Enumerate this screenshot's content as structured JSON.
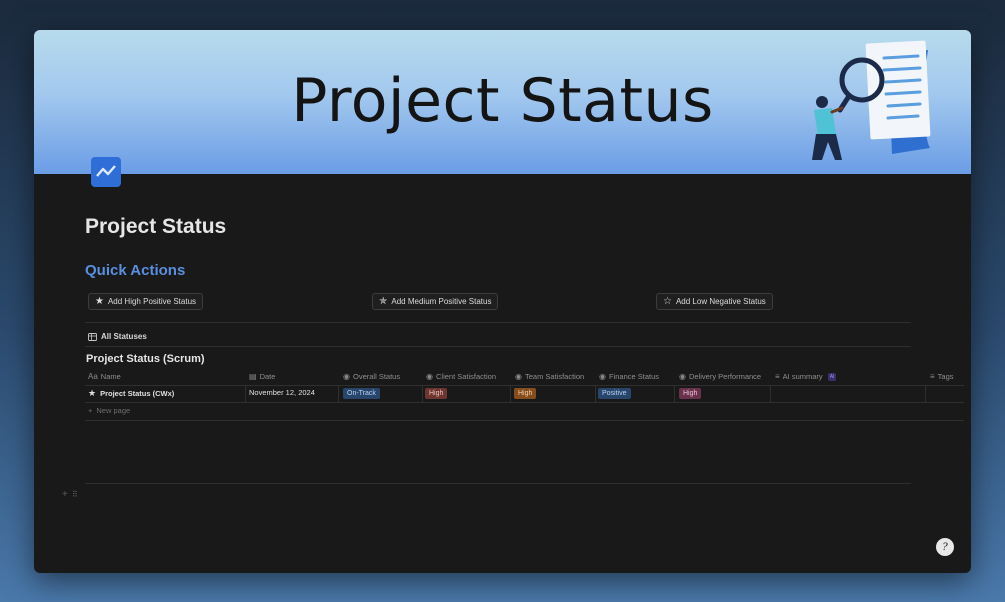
{
  "cover": {
    "title": "Project Status"
  },
  "page": {
    "title": "Project Status"
  },
  "quick_actions": {
    "heading": "Quick Actions",
    "buttons": [
      {
        "label": "Add High Positive Status",
        "icon": "star-filled-icon"
      },
      {
        "label": "Add Medium Positive Status",
        "icon": "star-sparkle-icon"
      },
      {
        "label": "Add Low Negative Status",
        "icon": "star-outline-icon"
      }
    ]
  },
  "view": {
    "tab_label": "All Statuses"
  },
  "database": {
    "title": "Project Status (Scrum)",
    "columns": [
      {
        "label": "Name",
        "icon": "Aa"
      },
      {
        "label": "Date",
        "icon": "calendar-icon"
      },
      {
        "label": "Overall Status",
        "icon": "status-icon"
      },
      {
        "label": "Client Satisfaction",
        "icon": "status-icon"
      },
      {
        "label": "Team Satisfaction",
        "icon": "status-icon"
      },
      {
        "label": "Finance Status",
        "icon": "status-icon"
      },
      {
        "label": "Delivery Performance",
        "icon": "status-icon"
      },
      {
        "label": "AI summary",
        "icon": "text-icon",
        "badge": "AI"
      },
      {
        "label": "Tags",
        "icon": "list-icon"
      }
    ],
    "rows": [
      {
        "name": "Project Status (CWx)",
        "date": "November 12, 2024",
        "overall_status": "On-Track",
        "client_satisfaction": "High",
        "team_satisfaction": "High",
        "finance_status": "Positive",
        "delivery_performance": "High"
      }
    ],
    "new_page_label": "New page"
  },
  "colors": {
    "accent_heading": "#5a8fe0",
    "tag_on_track": "#28456c",
    "tag_high_orange": "#854c1d",
    "tag_high_red": "#6e3630",
    "tag_positive": "#28456c",
    "tag_high_pink": "#69314c"
  }
}
